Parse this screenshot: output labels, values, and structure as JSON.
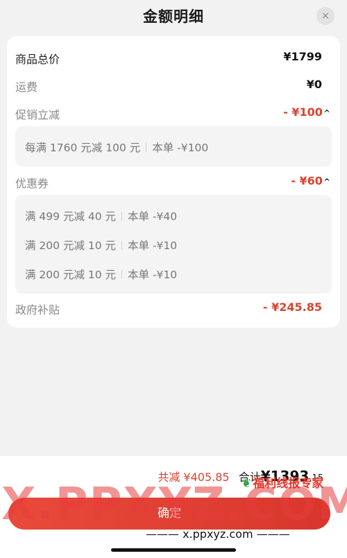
{
  "header": {
    "title": "金额明细",
    "close_icon": "×"
  },
  "rows": {
    "goods_total": {
      "label": "商品总价",
      "value": "¥1799"
    },
    "shipping": {
      "label": "运费",
      "value": "¥0"
    },
    "promotion": {
      "label": "促销立减",
      "value": "- ¥100",
      "chevron": "^"
    },
    "coupon": {
      "label": "优惠券",
      "value": "- ¥60",
      "chevron": "^"
    },
    "subsidy": {
      "label": "政府补贴",
      "value": "- ¥245.85"
    }
  },
  "promotion_items": [
    {
      "rule": "每满 1760 元减 100 元",
      "applied": "本单 -¥100"
    }
  ],
  "coupon_items": [
    {
      "rule": "满 499 元减 40 元",
      "applied": "本单 -¥40"
    },
    {
      "rule": "满 200 元减 10 元",
      "applied": "本单 -¥10"
    },
    {
      "rule": "满 200 元减 10 元",
      "applied": "本单 -¥10"
    }
  ],
  "footer": {
    "saved_label": "共减 ¥405.85",
    "total_label": "合计",
    "total_currency": "¥",
    "total_int": "1393",
    "total_dec": ".15",
    "confirm_label": "确定"
  },
  "watermark": {
    "big": "X.PPXYZ.COM",
    "brand": "福利线报专家",
    "url": "——— x.ppxyz.com ———"
  },
  "colors": {
    "discount_red": "#d9432f",
    "button_red": "#e94a3a",
    "background": "#f2f2f2"
  }
}
